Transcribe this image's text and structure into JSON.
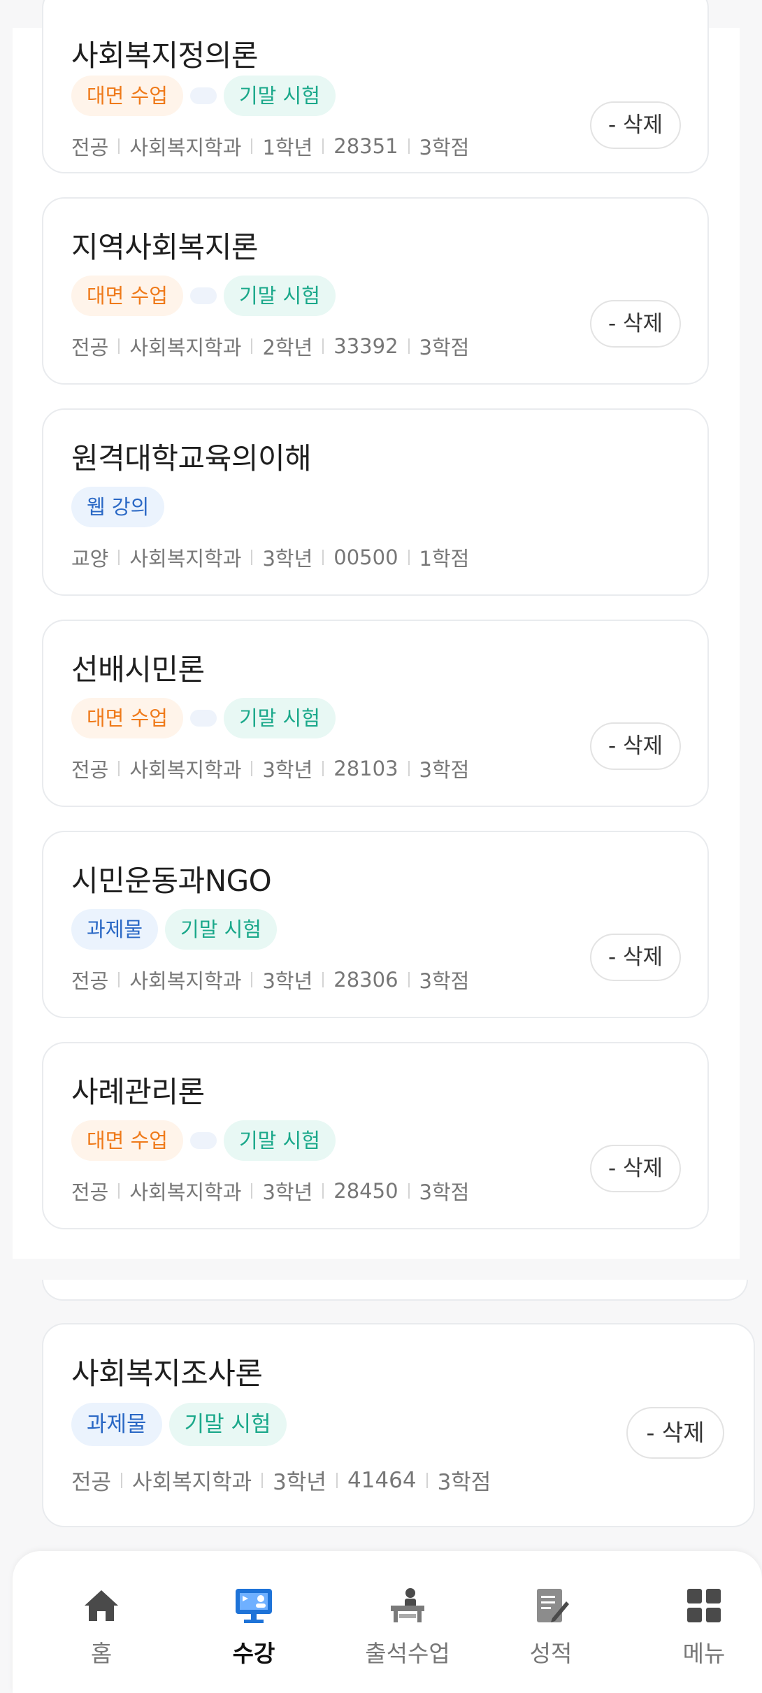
{
  "courses": [
    {
      "title": "사회복지정의론",
      "tags": [
        {
          "label": "대면 수업",
          "style": "orange"
        },
        {
          "label": "",
          "style": "empty"
        },
        {
          "label": "기말 시험",
          "style": "teal"
        }
      ],
      "meta": [
        "전공",
        "사회복지학과",
        "1학년",
        "28351",
        "3학점"
      ],
      "delete": "- 삭제"
    },
    {
      "title": "지역사회복지론",
      "tags": [
        {
          "label": "대면 수업",
          "style": "orange"
        },
        {
          "label": "",
          "style": "empty"
        },
        {
          "label": "기말 시험",
          "style": "teal"
        }
      ],
      "meta": [
        "전공",
        "사회복지학과",
        "2학년",
        "33392",
        "3학점"
      ],
      "delete": "- 삭제"
    },
    {
      "title": "원격대학교육의이해",
      "tags": [
        {
          "label": "웹 강의",
          "style": "blue"
        }
      ],
      "meta": [
        "교양",
        "사회복지학과",
        "3학년",
        "00500",
        "1학점"
      ],
      "delete": ""
    },
    {
      "title": "선배시민론",
      "tags": [
        {
          "label": "대면 수업",
          "style": "orange"
        },
        {
          "label": "",
          "style": "empty"
        },
        {
          "label": "기말 시험",
          "style": "teal"
        }
      ],
      "meta": [
        "전공",
        "사회복지학과",
        "3학년",
        "28103",
        "3학점"
      ],
      "delete": "- 삭제"
    },
    {
      "title": "시민운동과NGO",
      "tags": [
        {
          "label": "과제물",
          "style": "blue"
        },
        {
          "label": "기말 시험",
          "style": "teal"
        }
      ],
      "meta": [
        "전공",
        "사회복지학과",
        "3학년",
        "28306",
        "3학점"
      ],
      "delete": "- 삭제"
    },
    {
      "title": "사례관리론",
      "tags": [
        {
          "label": "대면 수업",
          "style": "orange"
        },
        {
          "label": "",
          "style": "empty"
        },
        {
          "label": "기말 시험",
          "style": "teal"
        }
      ],
      "meta": [
        "전공",
        "사회복지학과",
        "3학년",
        "28450",
        "3학점"
      ],
      "delete": "- 삭제"
    }
  ],
  "featured": {
    "title": "사회복지조사론",
    "tags": [
      {
        "label": "과제물",
        "style": "blue"
      },
      {
        "label": "기말 시험",
        "style": "teal"
      }
    ],
    "meta": [
      "전공",
      "사회복지학과",
      "3학년",
      "41464",
      "3학점"
    ],
    "delete": "- 삭제"
  },
  "tabs": [
    {
      "label": "홈",
      "icon": "home-icon"
    },
    {
      "label": "수강",
      "icon": "monitor-icon",
      "active": true
    },
    {
      "label": "출석수업",
      "icon": "classroom-icon"
    },
    {
      "label": "성적",
      "icon": "report-icon"
    },
    {
      "label": "메뉴",
      "icon": "grid-icon"
    }
  ],
  "colors": {
    "orange": "#ef7a1a",
    "teal": "#1aa88a",
    "blue": "#2a68c5",
    "active_icon": "#1e73d8"
  }
}
